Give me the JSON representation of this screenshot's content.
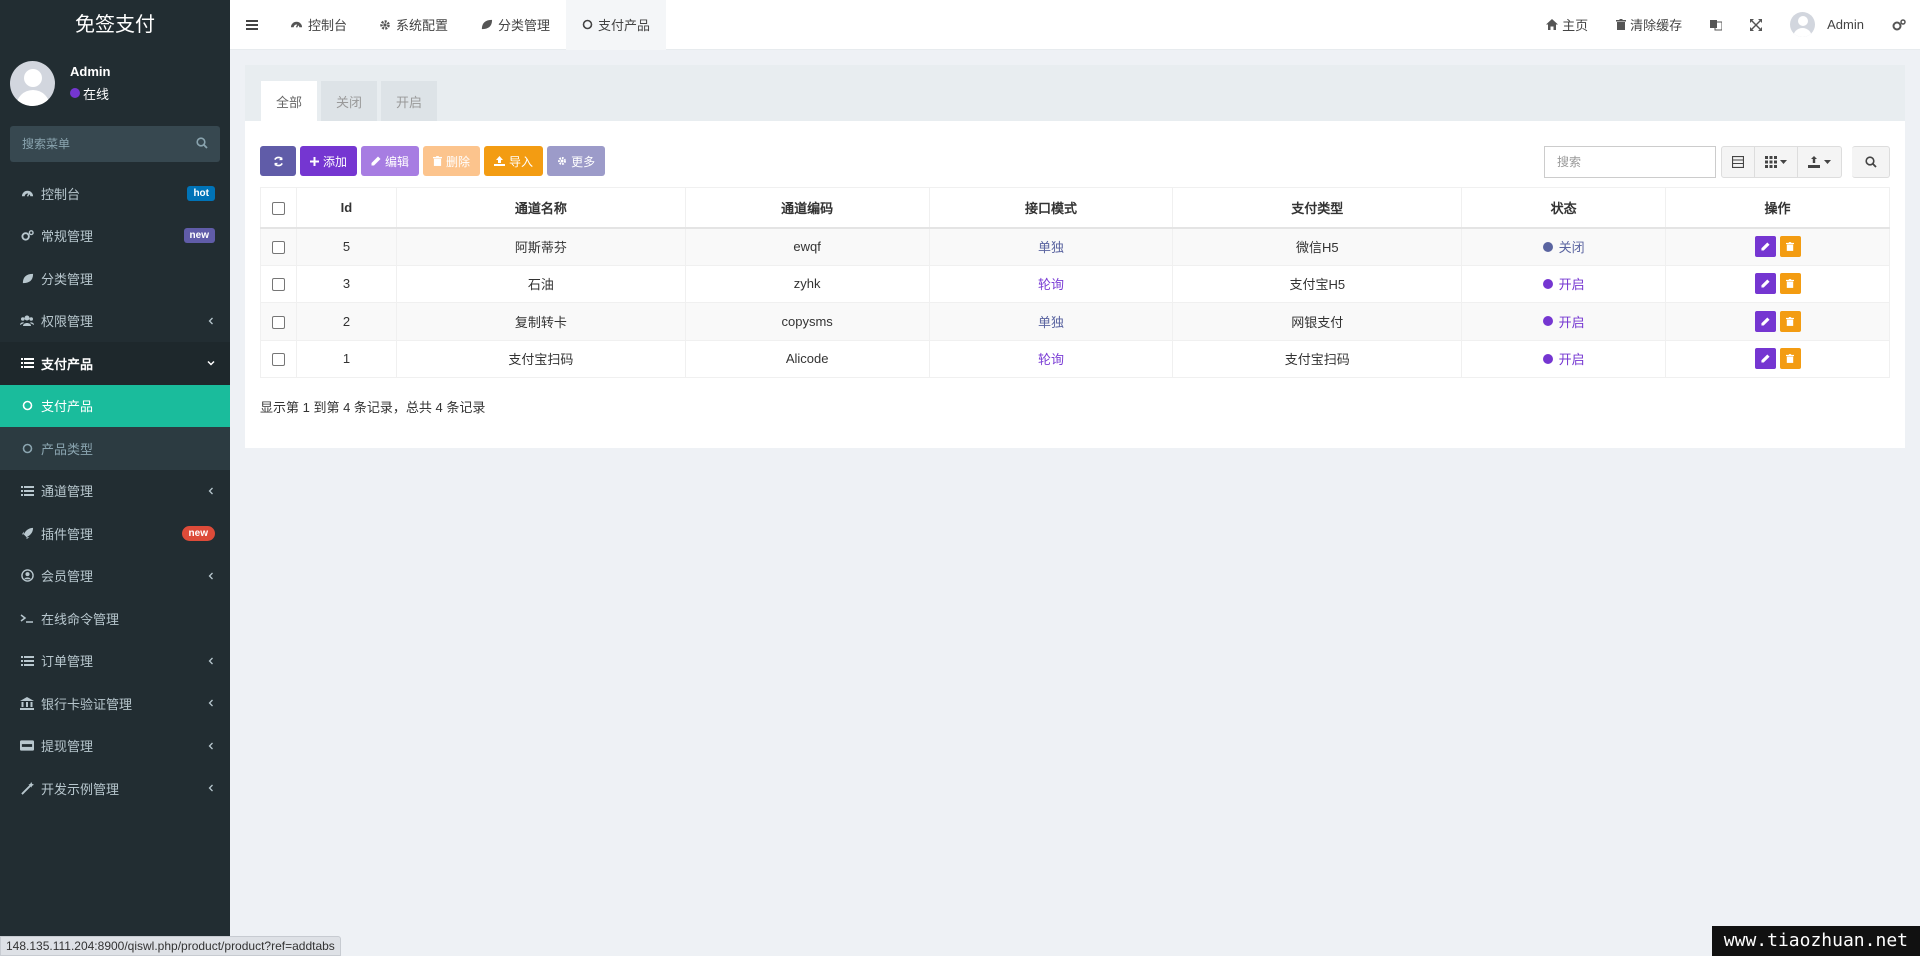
{
  "colors": {
    "sidebar_bg": "#222d32",
    "active_menu": "#1abc9c",
    "primary_purple": "#7536d1",
    "online_dot": "#7536d1",
    "closed_dot": "#5a64a0"
  },
  "app": {
    "title": "免签支付"
  },
  "user": {
    "name": "Admin",
    "status": "在线"
  },
  "sidebar": {
    "search_placeholder": "搜索菜单",
    "items": [
      {
        "label": "控制台",
        "icon": "dashboard-icon",
        "badge": "hot"
      },
      {
        "label": "常规管理",
        "icon": "cogs-icon",
        "badge": "new"
      },
      {
        "label": "分类管理",
        "icon": "leaf-icon"
      },
      {
        "label": "权限管理",
        "icon": "group-icon"
      },
      {
        "label": "支付产品",
        "icon": "list-icon"
      },
      {
        "label": "支付产品",
        "icon": "circle-o-icon"
      },
      {
        "label": "产品类型",
        "icon": "circle-o-icon"
      },
      {
        "label": "通道管理",
        "icon": "list-icon"
      },
      {
        "label": "插件管理",
        "icon": "rocket-icon",
        "badge": "new"
      },
      {
        "label": "会员管理",
        "icon": "user-circle-icon"
      },
      {
        "label": "在线命令管理",
        "icon": "terminal-icon"
      },
      {
        "label": "订单管理",
        "icon": "list-icon"
      },
      {
        "label": "银行卡验证管理",
        "icon": "bank-icon"
      },
      {
        "label": "提现管理",
        "icon": "visa-icon"
      },
      {
        "label": "开发示例管理",
        "icon": "magic-icon"
      }
    ]
  },
  "header": {
    "tabs": [
      {
        "label": "控制台",
        "icon": "dashboard-icon"
      },
      {
        "label": "系统配置",
        "icon": "cog-icon"
      },
      {
        "label": "分类管理",
        "icon": "leaf-icon"
      },
      {
        "label": "支付产品",
        "icon": "circle-o-icon"
      }
    ],
    "home": "主页",
    "clear_cache": "清除缓存",
    "admin": "Admin"
  },
  "panel": {
    "tabs": [
      "全部",
      "关闭",
      "开启"
    ],
    "toolbar": {
      "add": "添加",
      "edit": "编辑",
      "delete": "删除",
      "import": "导入",
      "more": "更多",
      "search_placeholder": "搜索"
    },
    "table": {
      "columns": [
        "Id",
        "通道名称",
        "通道编码",
        "接口模式",
        "支付类型",
        "状态",
        "操作"
      ],
      "rows": [
        {
          "id": "5",
          "name": "阿斯蒂芬",
          "code": "ewqf",
          "mode": "单独",
          "type": "微信H5",
          "status": "关闭"
        },
        {
          "id": "3",
          "name": "石油",
          "code": "zyhk",
          "mode": "轮询",
          "type": "支付宝H5",
          "status": "开启"
        },
        {
          "id": "2",
          "name": "复制转卡",
          "code": "copysms",
          "mode": "单独",
          "type": "网银支付",
          "status": "开启"
        },
        {
          "id": "1",
          "name": "支付宝扫码",
          "code": "Alicode",
          "mode": "轮询",
          "type": "支付宝扫码",
          "status": "开启"
        }
      ]
    },
    "pagination": "显示第 1 到第 4 条记录，总共 4 条记录"
  },
  "statusbar": {
    "url": "148.135.111.204:8900/qiswl.php/product/product?ref=addtabs"
  },
  "watermark": "www.tiaozhuan.net"
}
